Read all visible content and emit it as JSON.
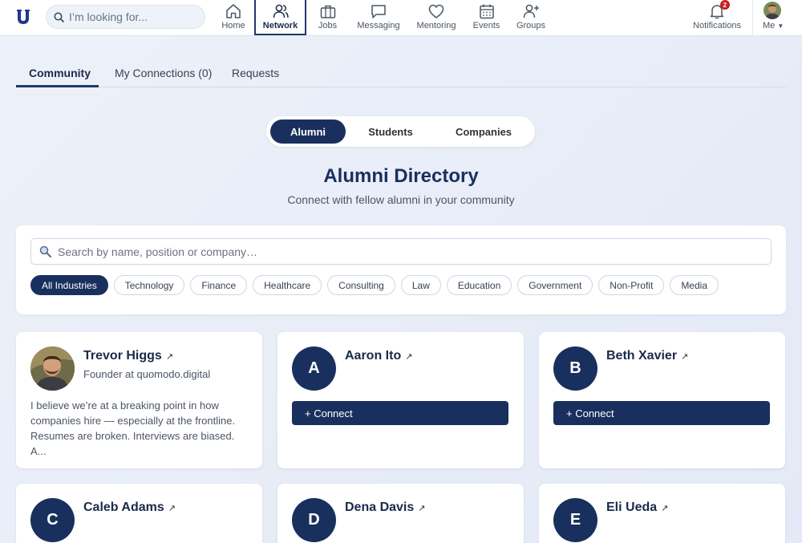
{
  "nav": {
    "search_placeholder": "I’m looking for...",
    "items": [
      {
        "label": "Home",
        "icon": "home-icon"
      },
      {
        "label": "Network",
        "icon": "network-icon"
      },
      {
        "label": "Jobs",
        "icon": "briefcase-icon"
      },
      {
        "label": "Messaging",
        "icon": "message-icon"
      },
      {
        "label": "Mentoring",
        "icon": "heart-icon"
      },
      {
        "label": "Events",
        "icon": "calendar-icon"
      },
      {
        "label": "Groups",
        "icon": "add-user-icon"
      }
    ],
    "notifications_label": "Notifications",
    "notifications_count": "2",
    "me_label": "Me",
    "active_item": "Network"
  },
  "tabs": [
    {
      "label": "Community"
    },
    {
      "label": "My Connections (0)"
    },
    {
      "label": "Requests"
    }
  ],
  "segment": [
    "Alumni",
    "Students",
    "Companies"
  ],
  "directory": {
    "title": "Alumni Directory",
    "subtitle": "Connect with fellow alumni in your community",
    "search_placeholder": "Search by name, position or company…"
  },
  "industries": [
    "All Industries",
    "Technology",
    "Finance",
    "Healthcare",
    "Consulting",
    "Law",
    "Education",
    "Government",
    "Non-Profit",
    "Media"
  ],
  "cards": [
    {
      "name": "Trevor Higgs",
      "role": "Founder at quomodo.digital",
      "bio": "I believe we’re at a breaking point in how companies hire — especially at the frontline. Resumes are broken. Interviews are biased. A..."
    },
    {
      "name": "Aaron Ito",
      "initial": "A",
      "connect": "+ Connect"
    },
    {
      "name": "Beth Xavier",
      "initial": "B",
      "connect": "+ Connect"
    },
    {
      "name": "Caleb Adams",
      "initial": "C"
    },
    {
      "name": "Dena Davis",
      "initial": "D"
    },
    {
      "name": "Eli Ueda",
      "initial": "E"
    }
  ],
  "colors": {
    "primary": "#19305e",
    "badge": "#c81e1e"
  }
}
